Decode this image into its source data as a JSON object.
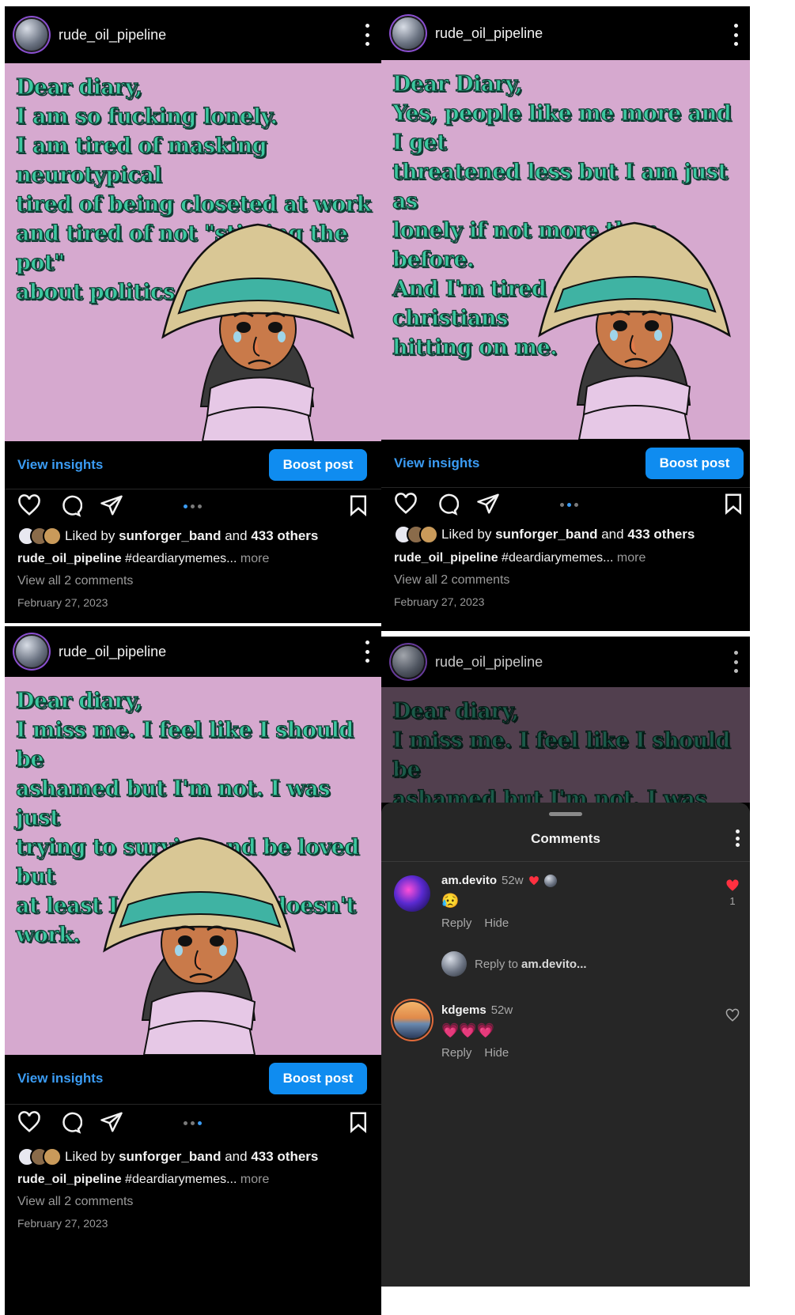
{
  "posts": [
    {
      "username": "rude_oil_pipeline",
      "meme_text": "Dear diary,\nI am so fucking lonely.\nI am tired of masking neurotypical\ntired of being closeted at work\nand tired of not \"stirring the pot\"\nabout politics.",
      "insights_label": "View insights",
      "boost_label": "Boost post",
      "liked_by_user": "sunforger_band",
      "liked_others": "433 others",
      "caption_user": "rude_oil_pipeline",
      "caption_text": "#deardiarymemes...",
      "more_label": "more",
      "view_comments": "View all 2 comments",
      "date": "February 27, 2023"
    },
    {
      "username": "rude_oil_pipeline",
      "meme_text": "Dear Diary,\nYes, people like me more and I get\nthreatened less but I am just as\nlonely if not more than before.\nAnd I'm tired of fucking christians\nhitting on me.",
      "insights_label": "View insights",
      "boost_label": "Boost post",
      "liked_by_user": "sunforger_band",
      "liked_others": "433 others",
      "caption_user": "rude_oil_pipeline",
      "caption_text": "#deardiarymemes...",
      "more_label": "more",
      "view_comments": "View all 2 comments",
      "date": "February 27, 2023"
    },
    {
      "username": "rude_oil_pipeline",
      "meme_text": "Dear diary,\nI miss me. I feel like I should be\nashamed but I'm not. I was just\ntrying to survive and be loved but\nat least I know now it doesn't work.",
      "insights_label": "View insights",
      "boost_label": "Boost post",
      "liked_by_user": "sunforger_band",
      "liked_others": "433 others",
      "caption_user": "rude_oil_pipeline",
      "caption_text": "#deardiarymemes...",
      "more_label": "more",
      "view_comments": "View all 2 comments",
      "date": "February 27, 2023"
    },
    {
      "username": "rude_oil_pipeline",
      "meme_text": "Dear diary,\nI miss me. I feel like I should be\nashamed but I'm not. I was just\ntrying to survive and be loved but"
    }
  ],
  "liked_prefix": "Liked by",
  "liked_and": "and",
  "comments_sheet": {
    "title": "Comments",
    "comments": [
      {
        "user": "am.devito",
        "time": "52w",
        "body": "😥",
        "reply": "Reply",
        "hide": "Hide",
        "likes": "1"
      },
      {
        "user": "kdgems",
        "time": "52w",
        "body": "💗💗💗",
        "reply": "Reply",
        "hide": "Hide"
      }
    ],
    "reply_prefix": "Reply to",
    "reply_user": "am.devito..."
  },
  "colors": {
    "meme_bg": "#d6a9cf",
    "meme_text": "#3cc8a0",
    "boost_bg": "#0f8cf0",
    "link_blue": "#3b9cf4"
  }
}
